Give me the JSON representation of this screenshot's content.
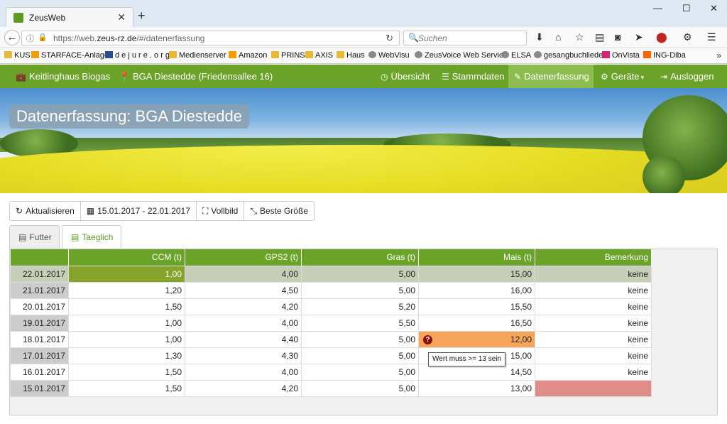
{
  "browser": {
    "tab_title": "ZeusWeb",
    "url_prefix": "https://web.",
    "url_domain": "zeus-rz.de",
    "url_path": "/#/datenerfassung",
    "search_placeholder": "Suchen"
  },
  "bookmarks": [
    {
      "label": "KUS",
      "icon": "folder-icon"
    },
    {
      "label": "STARFACE-Anlage",
      "icon": "starface-icon"
    },
    {
      "label": "d e j u r e . o r g",
      "icon": "dejure-icon"
    },
    {
      "label": "Medienserver",
      "icon": "folder-icon"
    },
    {
      "label": "Amazon",
      "icon": "amazon-icon"
    },
    {
      "label": "PRINS",
      "icon": "folder-icon"
    },
    {
      "label": "AXIS",
      "icon": "folder-icon"
    },
    {
      "label": "Haus",
      "icon": "folder-icon"
    },
    {
      "label": "WebVisu",
      "icon": "globe-icon"
    },
    {
      "label": "ZeusVoice Web Service",
      "icon": "globe-icon"
    },
    {
      "label": "ELSA",
      "icon": "globe-icon"
    },
    {
      "label": "gesangbuchlieder",
      "icon": "globe-icon"
    },
    {
      "label": "OnVista",
      "icon": "onvista-icon"
    },
    {
      "label": "ING-Diba",
      "icon": "ingdiba-icon"
    }
  ],
  "appnav": {
    "company": "Keitlinghaus Biogas",
    "site": "BGA Diestedde (Friedensallee 16)",
    "items": [
      {
        "label": "Übersicht",
        "icon": "clock-icon"
      },
      {
        "label": "Stammdaten",
        "icon": "list-icon"
      },
      {
        "label": "Datenerfassung",
        "icon": "pencil-icon"
      },
      {
        "label": "Geräte",
        "icon": "gear-icon"
      },
      {
        "label": "Ausloggen",
        "icon": "logout-icon"
      }
    ]
  },
  "hero": {
    "title": "Datenerfassung: BGA Diestedde"
  },
  "toolbar": {
    "refresh": "Aktualisieren",
    "date_range": "15.01.2017 - 22.01.2017",
    "fullscreen": "Vollbild",
    "best_size": "Beste Größe"
  },
  "tabs": [
    {
      "label": "Futter"
    },
    {
      "label": "Taeglich"
    }
  ],
  "grid": {
    "columns": [
      "",
      "CCM (t)",
      "GPS2 (t)",
      "Gras (t)",
      "Mais (t)",
      "Bemerkung"
    ],
    "rows": [
      [
        "22.01.2017",
        "1,00",
        "4,00",
        "5,00",
        "15,00",
        "keine"
      ],
      [
        "21.01.2017",
        "1,20",
        "4,50",
        "5,00",
        "16,00",
        "keine"
      ],
      [
        "20.01.2017",
        "1,50",
        "4,20",
        "5,20",
        "15,50",
        "keine"
      ],
      [
        "19.01.2017",
        "1,00",
        "4,00",
        "5,50",
        "16,50",
        "keine"
      ],
      [
        "18.01.2017",
        "1,00",
        "4,40",
        "5,00",
        "12,00",
        "keine"
      ],
      [
        "17.01.2017",
        "1,30",
        "4,30",
        "5,00",
        "15,00",
        "keine"
      ],
      [
        "16.01.2017",
        "1,50",
        "4,00",
        "5,00",
        "14,50",
        "keine"
      ],
      [
        "15.01.2017",
        "1,50",
        "4,20",
        "5,00",
        "13,00",
        ""
      ]
    ],
    "error_badge": "?",
    "tooltip": "Wert muss >= 13 sein"
  }
}
